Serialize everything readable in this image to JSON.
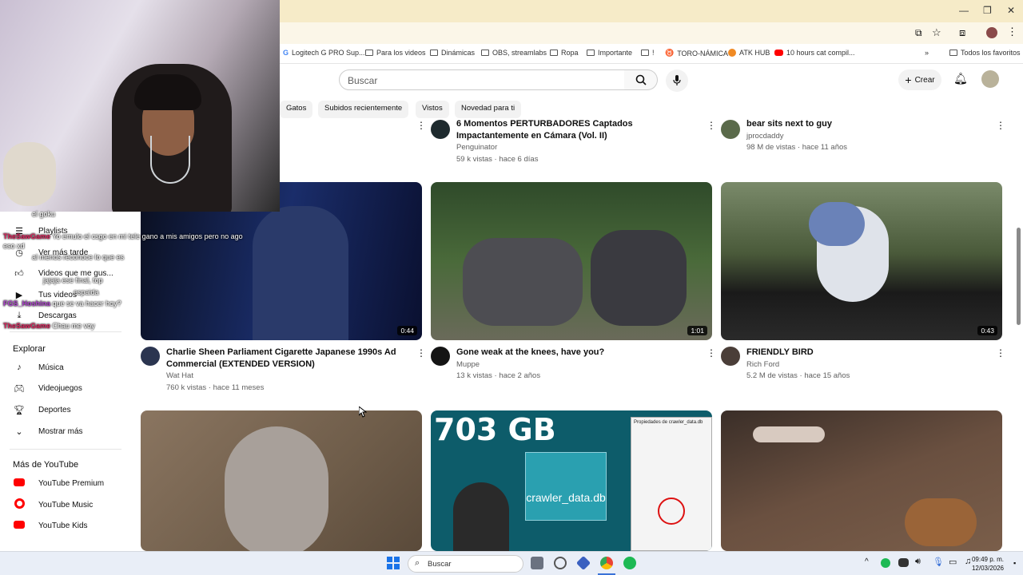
{
  "browser": {
    "bookmarks": [
      "Logitech G PRO Sup...",
      "Para los videos",
      "Dinámicas",
      "OBS, streamlabs",
      "Ropa",
      "Importante",
      "!",
      "TORO-NÁMICA",
      "ATK HUB",
      "10 hours cat compil..."
    ],
    "all_bookmarks": "Todos los favoritos"
  },
  "youtube": {
    "search_placeholder": "Buscar",
    "create_label": "Crear",
    "chips": [
      "Gatos",
      "Subidos recientemente",
      "Vistos",
      "Novedad para ti"
    ]
  },
  "sidebar": {
    "you_items": [
      {
        "label": "Playlists",
        "icon": "playlist-icon"
      },
      {
        "label": "Ver más tarde",
        "icon": "clock-icon"
      },
      {
        "label": "Videos que me gus...",
        "icon": "thumbs-up-icon"
      },
      {
        "label": "Tus videos",
        "icon": "video-icon"
      },
      {
        "label": "Descargas",
        "icon": "download-icon"
      }
    ],
    "explore_heading": "Explorar",
    "explore_items": [
      {
        "label": "Música",
        "icon": "music-icon"
      },
      {
        "label": "Videojuegos",
        "icon": "gamepad-icon"
      },
      {
        "label": "Deportes",
        "icon": "trophy-icon"
      },
      {
        "label": "Mostrar más",
        "icon": "chevron-down-icon"
      }
    ],
    "more_heading": "Más de YouTube",
    "more_items": [
      {
        "label": "YouTube Premium"
      },
      {
        "label": "YouTube Music"
      },
      {
        "label": "YouTube Kids"
      }
    ]
  },
  "chat_overlay": [
    {
      "user": "",
      "msg": "el goku"
    },
    {
      "user": "TheSawGame",
      "msg": "Yo emulo el csgo en mi tele gano a mis amigos pero no ago"
    },
    {
      "user": "",
      "msg": "eso xd"
    },
    {
      "user": "",
      "msg": "al menos reconoce lo que es"
    },
    {
      "user": "",
      "msg": "jajaja ese final, top"
    },
    {
      "user": "",
      "msg": "espaida"
    },
    {
      "user": "FGS_Hoshina",
      "msg": "que se va hacer hoy?"
    },
    {
      "user": "TheSawGame",
      "msg": "Chau me voy"
    }
  ],
  "videos_top_row": [
    {
      "title": "6 Momentos PERTURBADORES Captados Impactantemente en Cámara (Vol. II)",
      "channel": "Penguinator",
      "meta": "59 k vistas · hace 6 días"
    },
    {
      "title": "bear sits next to guy",
      "channel": "jprocdaddy",
      "meta": "98 M de vistas · hace 11 años"
    }
  ],
  "videos": [
    {
      "title": "Charlie Sheen Parliament Cigarette Japanese 1990s Ad Commercial (EXTENDED VERSION)",
      "channel": "Wat Hat",
      "meta": "760 k vistas · hace 11 meses",
      "duration": "0:44"
    },
    {
      "title": "Gone weak at the knees, have you?",
      "channel": "Muppe",
      "meta": "13 k vistas · hace 2 años",
      "duration": "1:01"
    },
    {
      "title": "FRIENDLY BIRD",
      "channel": "Rich Ford",
      "meta": "5.2 M de vistas · hace 15 años",
      "duration": "0:43"
    }
  ],
  "thumb_text": {
    "big": "703 GB",
    "file": "crawler_data.db",
    "dialog_title": "Propiedades de crawler_data.db"
  },
  "taskbar": {
    "search": "Buscar",
    "time": "09:49 p. m.",
    "date": "12/03/2026"
  }
}
